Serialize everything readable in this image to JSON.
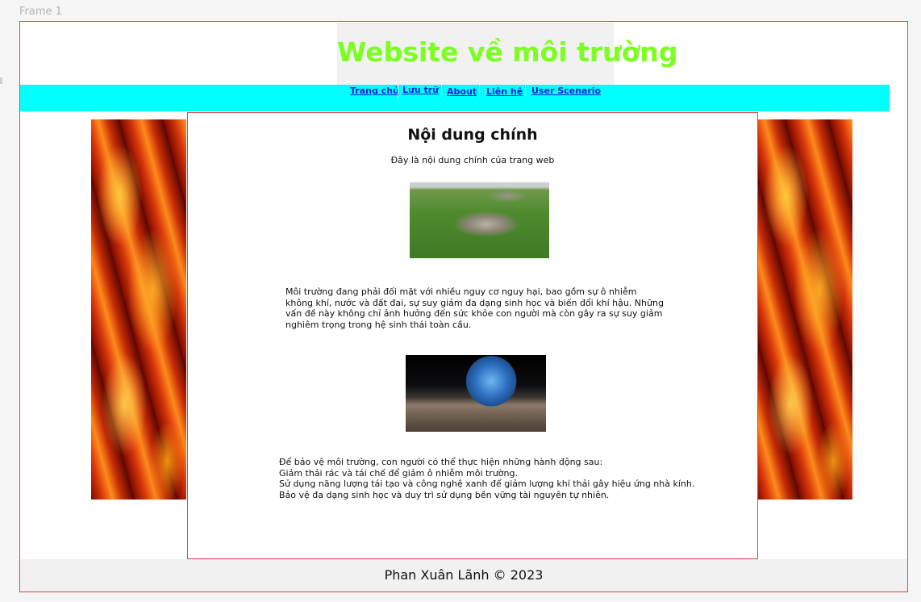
{
  "canvas": {
    "frame_label": "Frame 1"
  },
  "header": {
    "title": "Website về môi trường",
    "title_color": "#7cff1f"
  },
  "nav": {
    "background": "#00ffff",
    "items": [
      {
        "label": "Trang chủ"
      },
      {
        "label": "Lưu trữ"
      },
      {
        "label": "About"
      },
      {
        "label": "Liên hệ"
      },
      {
        "label": "User Scenario"
      }
    ]
  },
  "main": {
    "title": "Nội dung chính",
    "subtitle": "Đây là nội dung chính của trang web",
    "paragraph1": "Môi trường đang phải đối mặt với nhiều nguy cơ nguy hại, bao gồm sự ô nhiễm không khí, nước và đất đai, sự suy giảm đa dạng sinh học và biến đổi khí hậu. Những vấn đề này không chỉ ảnh hưởng đến sức khỏe con người mà còn gây ra sự suy giảm nghiêm trọng trong hệ sinh thái toàn cầu.",
    "actions": [
      "Để bảo vệ môi trường, con người có thể thực hiện những hành động sau:",
      "Giảm thải rác và tái chế để giảm ô nhiễm môi trường.",
      "Sử dụng năng lượng tái tạo và công nghệ xanh để giảm lượng khí thải gây hiệu ứng nhà kính.",
      "Bảo vệ đa dạng sinh học và duy trì sử dụng bền vững tài nguyên tự nhiên."
    ]
  },
  "footer": {
    "text": "Phan Xuân Lãnh © 2023"
  },
  "colors": {
    "frame_border": "#e0464a",
    "link": "#1b1bd6"
  }
}
